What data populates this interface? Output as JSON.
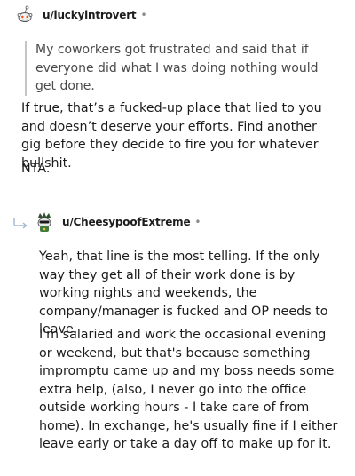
{
  "comment1": {
    "username": "u/luckyintrovert",
    "separator": "•",
    "quote": "My coworkers got frustrated and said that if everyone did what I was doing nothing would get done.",
    "paragraphs": [
      "If true, that’s a fucked-up place that lied to you and doesn’t deserve your efforts. Find another gig before they decide to fire you for whatever bullshit.",
      "NTA."
    ]
  },
  "comment2": {
    "username": "u/CheesypoofExtreme",
    "separator": "•",
    "paragraphs": [
      "Yeah, that line is the most telling. If the only way they get all of their work done is by working nights and weekends, the company/manager is fucked and OP needs to leave.",
      "I'm salaried and work the occasional evening or weekend, but that's because something impromptu came up and my boss needs some extra help, (also, I never go into the office outside working hours - I take care of from home). In exchange, he's usually fine if I either leave early or take a day off to make up for it."
    ]
  },
  "colors": {
    "text": "#1c1c1c",
    "quote_text": "#4a4a4a",
    "quote_bar": "#c4c4c4",
    "meta": "#878a8c"
  },
  "icons": {
    "avatar1": "snoo-avatar-icon",
    "avatar2": "snoo-avatar-icon",
    "reply": "reply-arrow-icon"
  }
}
